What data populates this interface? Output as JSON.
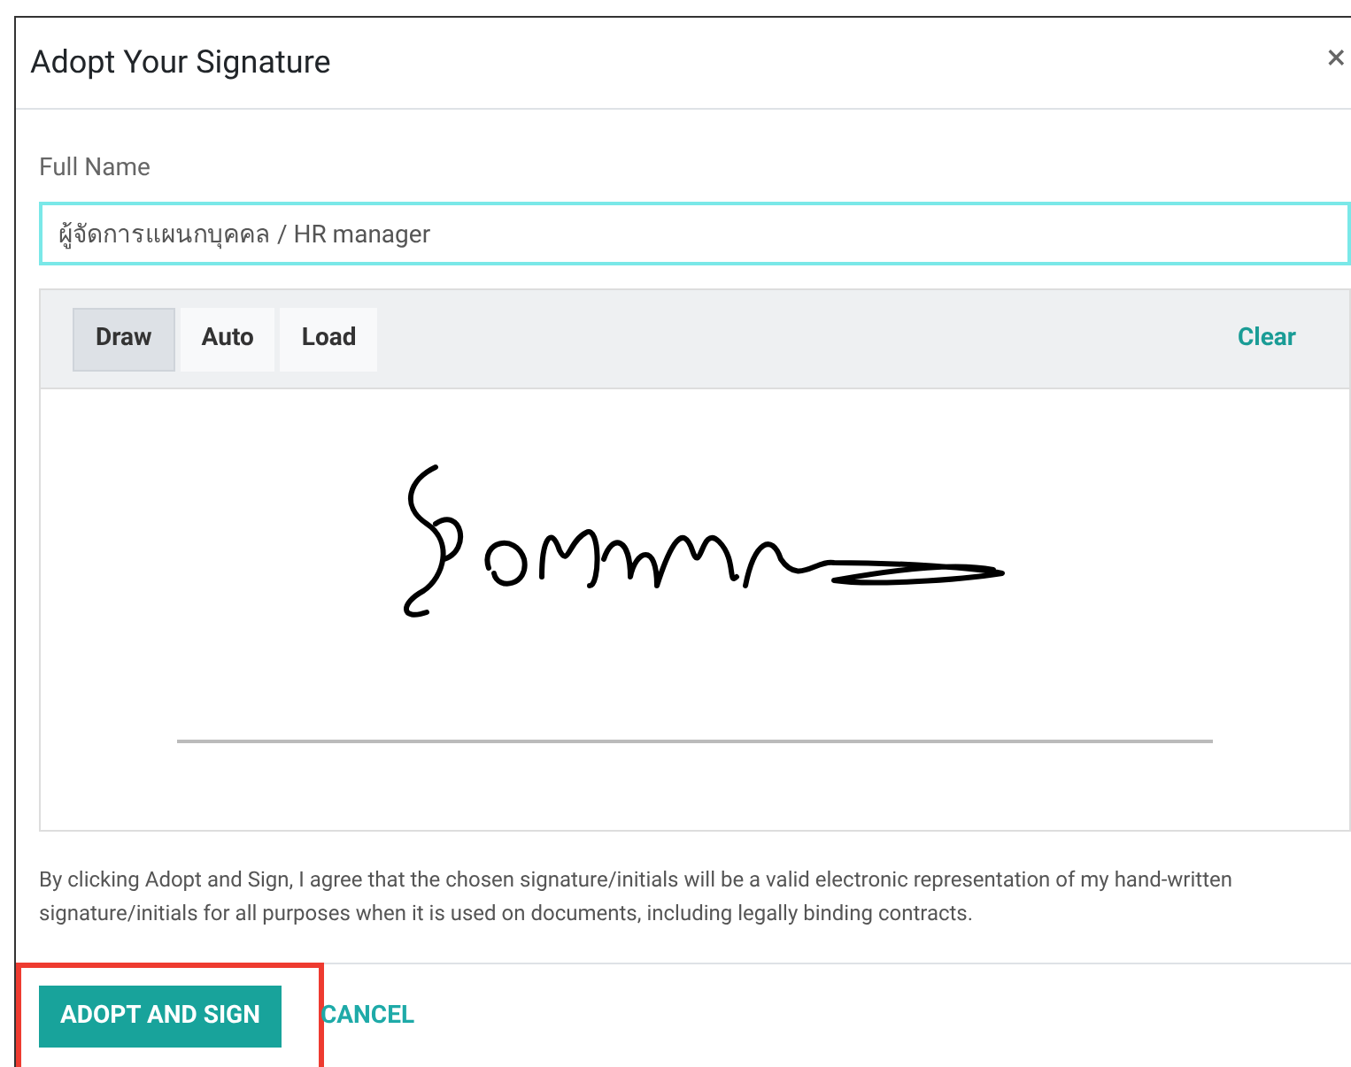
{
  "dialog": {
    "title": "Adopt Your Signature",
    "close": "×"
  },
  "full_name": {
    "label": "Full Name",
    "value": "ผู้จัดการแผนกบุคคล / HR manager"
  },
  "signature_pad": {
    "tabs": [
      {
        "label": "Draw",
        "selected": true
      },
      {
        "label": "Auto",
        "selected": false
      },
      {
        "label": "Load",
        "selected": false
      }
    ],
    "clear": "Clear"
  },
  "disclaimer": "By clicking Adopt and Sign, I agree that the chosen signature/initials will be a valid electronic representation of my hand-written signature/initials for all purposes when it is used on documents, including legally binding contracts.",
  "buttons": [
    {
      "label": "ADOPT AND SIGN",
      "kind": "primary",
      "highlighted": true
    },
    {
      "label": "CANCEL",
      "kind": "link",
      "highlighted": false
    }
  ]
}
